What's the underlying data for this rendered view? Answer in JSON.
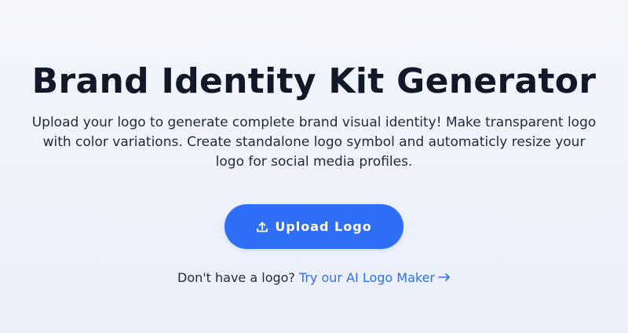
{
  "hero": {
    "title": "Brand Identity Kit Generator",
    "subtitle": "Upload your logo to generate complete brand visual identity! Make transparent logo with color variations. Create standalone logo symbol and automaticly resize your logo for social media profiles.",
    "upload_button": {
      "label": "Upload Logo",
      "icon": "upload-icon"
    },
    "alt_prompt": "Don't have a logo?",
    "alt_link": {
      "label": "Try our AI Logo Maker",
      "icon": "arrow-right-icon"
    }
  },
  "colors": {
    "accent": "#2f6ef6",
    "text": "#111827",
    "background_top": "#f4f6fb",
    "background_bottom": "#eaeffb"
  }
}
